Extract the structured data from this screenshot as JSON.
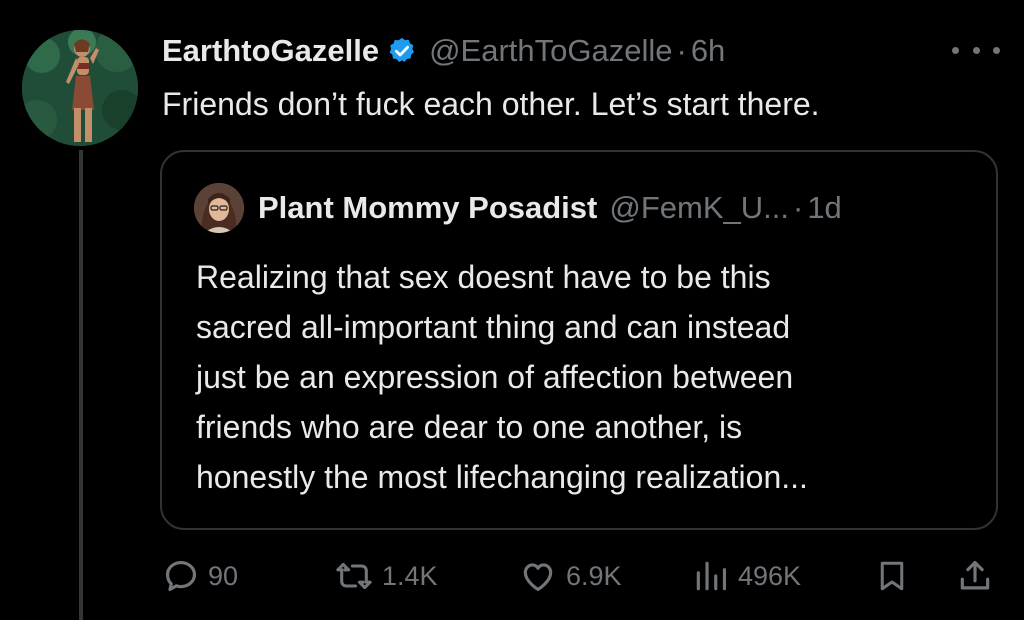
{
  "tweet": {
    "display_name": "EarthtoGazelle",
    "handle": "@EarthToGazelle",
    "separator": "·",
    "time": "6h",
    "text": "Friends don’t fuck each other. Let’s start there."
  },
  "quote": {
    "display_name": "Plant Mommy Posadist",
    "handle": "@FemK_U...",
    "separator": "·",
    "time": "1d",
    "text_lines": [
      "Realizing that sex doesnt have to be this",
      "sacred all-important thing and can instead",
      "just be an expression of affection between",
      "friends who are dear to one another, is",
      "honestly the most lifechanging realization..."
    ]
  },
  "actions": {
    "replies": "90",
    "reposts": "1.4K",
    "likes": "6.9K",
    "views": "496K"
  },
  "icons": {
    "verified": "verified-badge-icon",
    "more": "more-options-icon",
    "reply": "reply-icon",
    "repost": "repost-icon",
    "like": "heart-icon",
    "views": "views-chart-icon",
    "bookmark": "bookmark-icon",
    "share": "share-icon"
  },
  "colors": {
    "background": "#000000",
    "text_primary": "#e7e9ea",
    "text_secondary": "#71767b",
    "border": "#2f3336",
    "verified_blue": "#1d9bf0"
  }
}
